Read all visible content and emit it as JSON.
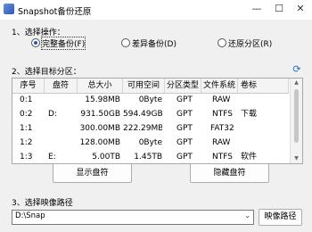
{
  "window": {
    "title": "Snapshot备份还原",
    "minimize_glyph": "—",
    "maximize_glyph": "☐",
    "close_glyph": "✕"
  },
  "step1": {
    "label": "1、选择操作：",
    "options": [
      {
        "label": "完整备份(F)",
        "checked": true
      },
      {
        "label": "差异备份(D)",
        "checked": false
      },
      {
        "label": "还原分区(R)",
        "checked": false
      }
    ]
  },
  "step2": {
    "label": "2、选择目标分区：",
    "refresh_icon": "refresh-icon",
    "columns": [
      "序号",
      "盘符",
      "总大小",
      "可用空间",
      "分区类型",
      "文件系统",
      "卷标"
    ],
    "rows": [
      [
        "0:1",
        "",
        "15.98MB",
        "0Byte",
        "GPT",
        "RAW",
        ""
      ],
      [
        "0:2",
        "D:",
        "931.50GB",
        "594.49GB",
        "GPT",
        "NTFS",
        "下载"
      ],
      [
        "1:1",
        "",
        "300.00MB",
        "222.29MB",
        "GPT",
        "FAT32",
        ""
      ],
      [
        "1:2",
        "",
        "128.00MB",
        "0Byte",
        "GPT",
        "RAW",
        ""
      ],
      [
        "1:3",
        "E:",
        "5.00TB",
        "1.45TB",
        "GPT",
        "NTFS",
        "软件"
      ]
    ],
    "show_drive_letter_button": "显示盘符",
    "hide_drive_letter_button": "隐藏盘符"
  },
  "step3": {
    "label": "3、选择映像路径",
    "path_value": "D:\\Snap",
    "browse_button": "映像路径"
  }
}
